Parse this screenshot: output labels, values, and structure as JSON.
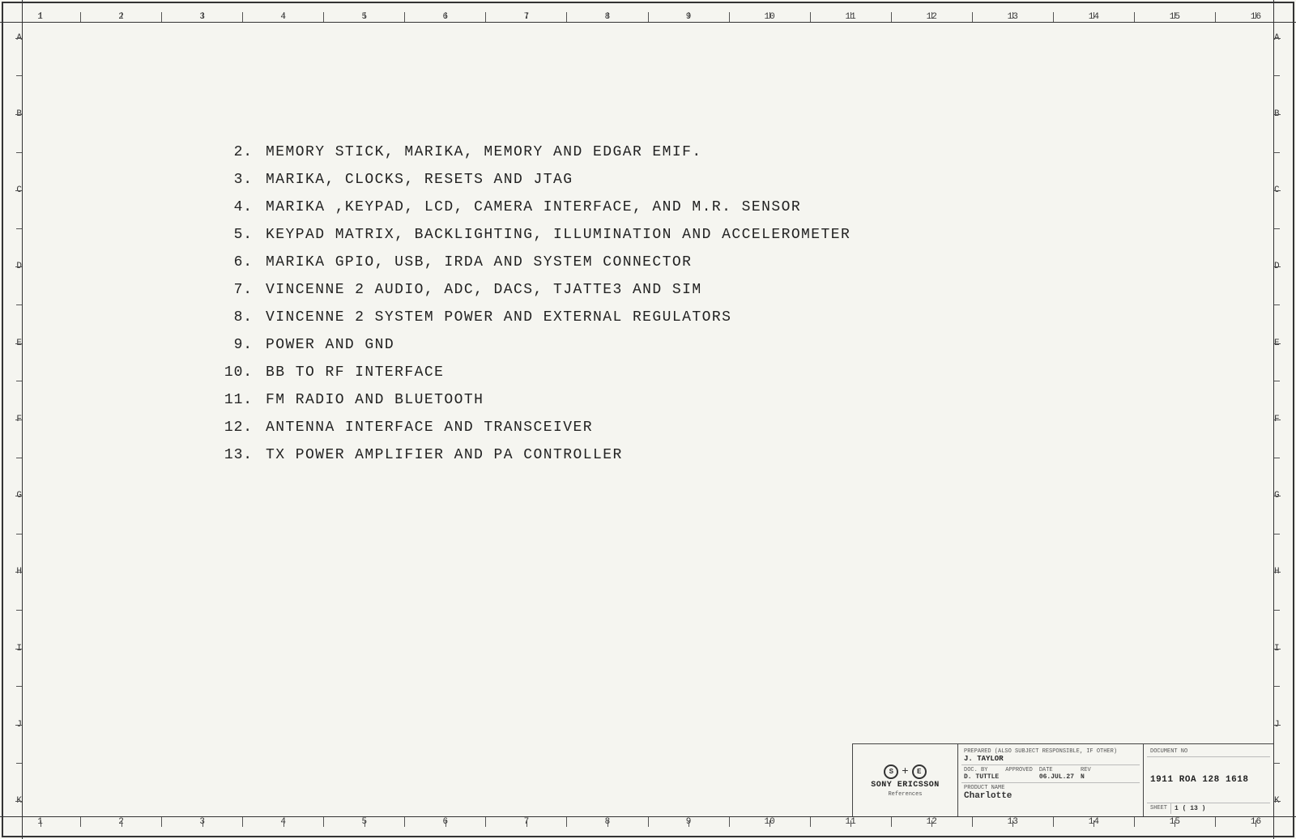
{
  "grid": {
    "columns": [
      "1",
      "2",
      "3",
      "4",
      "5",
      "6",
      "7",
      "8",
      "9",
      "10",
      "11",
      "12",
      "13",
      "14",
      "15",
      "16"
    ],
    "rows": [
      "A",
      "B",
      "C",
      "D",
      "E",
      "F",
      "G",
      "H",
      "I",
      "J",
      "K"
    ]
  },
  "list": {
    "items": [
      {
        "num": "2.",
        "text": "MEMORY   STICK, MARIKA, MEMORY AND EDGAR EMIF."
      },
      {
        "num": "3.",
        "text": "MARIKA, CLOCKS,   RESETS AND JTAG"
      },
      {
        "num": "4.",
        "text": "MARIKA ,KEYPAD, LCD, CAMERA INTERFACE, AND M.R. SENSOR"
      },
      {
        "num": "5.",
        "text": "KEYPAD MATRIX, BACKLIGHTING, ILLUMINATION AND ACCELEROMETER"
      },
      {
        "num": "6.",
        "text": "MARIKA GPIO, USB, IRDA AND SYSTEM CONNECTOR"
      },
      {
        "num": "7.",
        "text": "VINCENNE 2 AUDIO, ADC, DACS, TJATTE3 AND SIM"
      },
      {
        "num": "8.",
        "text": "VINCENNE 2 SYSTEM POWER AND EXTERNAL REGULATORS"
      },
      {
        "num": "9.",
        "text": "POWER AND GND"
      },
      {
        "num": "10.",
        "text": "BB TO RF INTERFACE"
      },
      {
        "num": "11.",
        "text": "FM RADIO AND BLUETOOTH"
      },
      {
        "num": "12.",
        "text": "ANTENNA INTERFACE AND TRANSCEIVER"
      },
      {
        "num": "13.",
        "text": "TX POWER AMPLIFIER AND PA CONTROLLER"
      }
    ]
  },
  "titleblock": {
    "company": "SONY ERICSSON",
    "logo_symbol": "⊕",
    "prepared_label": "PREPARED (ALSO",
    "subject_responsible_label": "SUBJECT RESPONSIBLE, IF OTHER)",
    "prepared_by": "J. TAYLOR",
    "doc_by_label": "DOC. BY",
    "approved_label": "APPROVED",
    "doc_by": "D. TUTTLE",
    "approved_by": "",
    "date_label": "DATE",
    "rev_label": "REV",
    "date": "06.JUL.27",
    "rev": "N",
    "product_name_label": "PRODUCT NAME",
    "product_name": "Charlotte",
    "document_no": "1911 ROA 128 1618",
    "sheet_label": "SHEET",
    "sheet": "1 ( 13 )",
    "references_label": "References"
  }
}
